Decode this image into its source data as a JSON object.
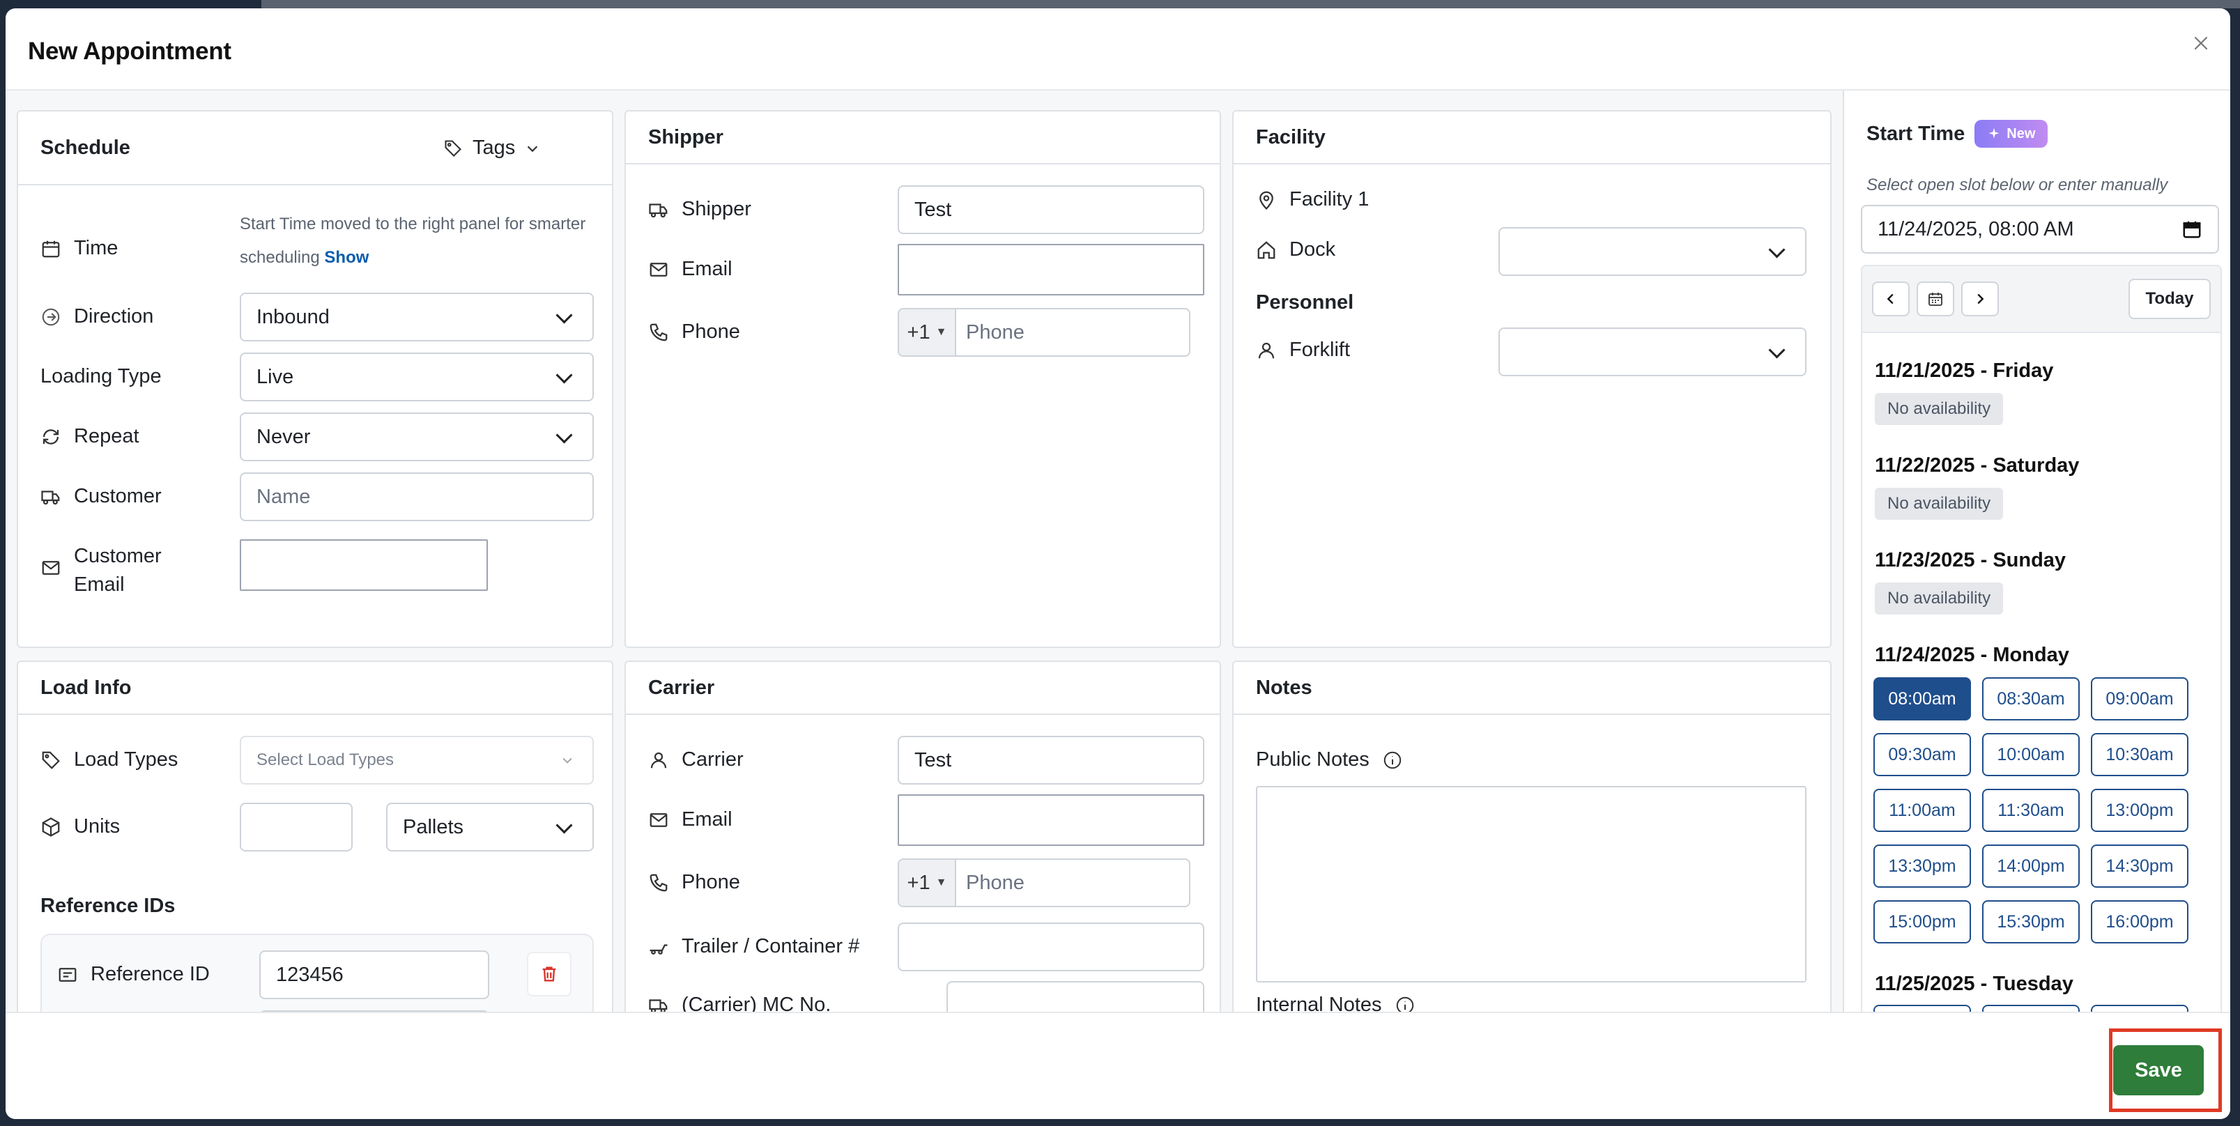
{
  "modal": {
    "title": "New Appointment"
  },
  "schedule": {
    "heading": "Schedule",
    "tags_label": "Tags",
    "time_label": "Time",
    "time_hint": "Start Time moved to the right panel for smarter scheduling",
    "time_hint_link": "Show",
    "direction_label": "Direction",
    "direction_value": "Inbound",
    "loading_type_label": "Loading Type",
    "loading_type_value": "Live",
    "repeat_label": "Repeat",
    "repeat_value": "Never",
    "customer_label": "Customer",
    "customer_placeholder": "Name",
    "customer_email_label_1": "Customer",
    "customer_email_label_2": "Email",
    "customer_email_value": ""
  },
  "shipper": {
    "heading": "Shipper",
    "shipper_label": "Shipper",
    "shipper_value": "Test",
    "email_label": "Email",
    "email_value": "",
    "phone_label": "Phone",
    "phone_prefix": "+1",
    "phone_placeholder": "Phone"
  },
  "facility": {
    "heading": "Facility",
    "facility_name": "Facility 1",
    "dock_label": "Dock",
    "dock_value": "",
    "personnel_heading": "Personnel",
    "forklift_label": "Forklift",
    "forklift_value": ""
  },
  "load_info": {
    "heading": "Load Info",
    "load_types_label": "Load Types",
    "load_types_placeholder": "Select Load Types",
    "units_label": "Units",
    "units_value": "",
    "units_type_value": "Pallets",
    "reference_ids_heading": "Reference IDs",
    "reference_id_label": "Reference ID",
    "reference_id_value": "123456"
  },
  "carrier": {
    "heading": "Carrier",
    "carrier_label": "Carrier",
    "carrier_value": "Test",
    "email_label": "Email",
    "email_value": "",
    "phone_label": "Phone",
    "phone_prefix": "+1",
    "phone_placeholder": "Phone",
    "trailer_label": "Trailer / Container #",
    "trailer_value": "",
    "mc_label": "(Carrier) MC No.",
    "mc_value": ""
  },
  "notes": {
    "heading": "Notes",
    "public_notes_label": "Public Notes",
    "internal_notes_label": "Internal Notes"
  },
  "start_time": {
    "heading": "Start Time",
    "new_badge": "New",
    "hint": "Select open slot below or enter manually",
    "datetime_value": "11/24/2025, 08:00  AM",
    "today_label": "Today",
    "days": [
      {
        "title": "11/21/2025 - Friday",
        "status": "No availability"
      },
      {
        "title": "11/22/2025 - Saturday",
        "status": "No availability"
      },
      {
        "title": "11/23/2025 - Sunday",
        "status": "No availability"
      },
      {
        "title": "11/24/2025 - Monday",
        "status": ""
      },
      {
        "title": "11/25/2025 - Tuesday",
        "status": ""
      }
    ],
    "slots": [
      "08:00am",
      "08:30am",
      "09:00am",
      "09:30am",
      "10:00am",
      "10:30am",
      "11:00am",
      "11:30am",
      "13:00pm",
      "13:30pm",
      "14:00pm",
      "14:30pm",
      "15:00pm",
      "15:30pm",
      "16:00pm"
    ],
    "selected_slot": "08:00am"
  },
  "footer": {
    "save_label": "Save"
  },
  "colors": {
    "primary": "#1f4e8c",
    "save": "#2f7d3a",
    "highlight": "#e03a25",
    "link": "#0b5cad"
  }
}
